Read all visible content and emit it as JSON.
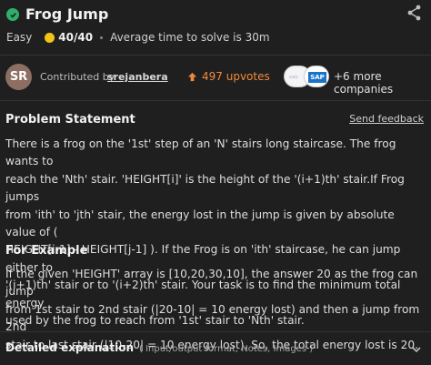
{
  "header": {
    "title": "Frog Jump",
    "difficulty": "Easy",
    "score": "40/40",
    "avg_time": "Average time to solve is 30m"
  },
  "contributor": {
    "avatar_initials": "SR",
    "label": "Contributed by",
    "name": "srejanbera",
    "upvotes": "497 upvotes",
    "companies_more": "+6 more companies"
  },
  "problem": {
    "heading": "Problem Statement",
    "feedback_link": "Send feedback",
    "lines": [
      "There is a frog on the '1st' step of an 'N' stairs long staircase. The frog wants to",
      "reach the 'Nth' stair. 'HEIGHT[i]' is the height of the '(i+1)th' stair.If Frog jumps",
      "from 'ith' to 'jth' stair, the energy lost in the jump is given by absolute value of (",
      "HEIGHT[i-1] - HEIGHT[j-1] ). If the Frog is on 'ith' staircase, he can jump either to",
      "'(i+1)th' stair or to '(i+2)th' stair. Your task is to find the minimum total energy",
      "used by the frog to reach from '1st' stair to 'Nth' stair."
    ],
    "example_heading": "For Example",
    "example_lines": [
      "If the given 'HEIGHT' array is [10,20,30,10], the answer 20 as the frog can jump",
      "from 1st stair to 2nd stair (|20-10| = 10 energy lost) and then a jump from 2nd",
      "stair to last stair (|10-20| = 10 energy lost). So, the total energy lost is 20."
    ]
  },
  "details": {
    "label": "Detailed explanation",
    "sublabel": "( Input/output format, Notes, Images )"
  },
  "colors": {
    "background": "#1f1f1f",
    "success": "#2fb06a",
    "upvote": "#f08a3b",
    "coin": "#f0c419"
  }
}
